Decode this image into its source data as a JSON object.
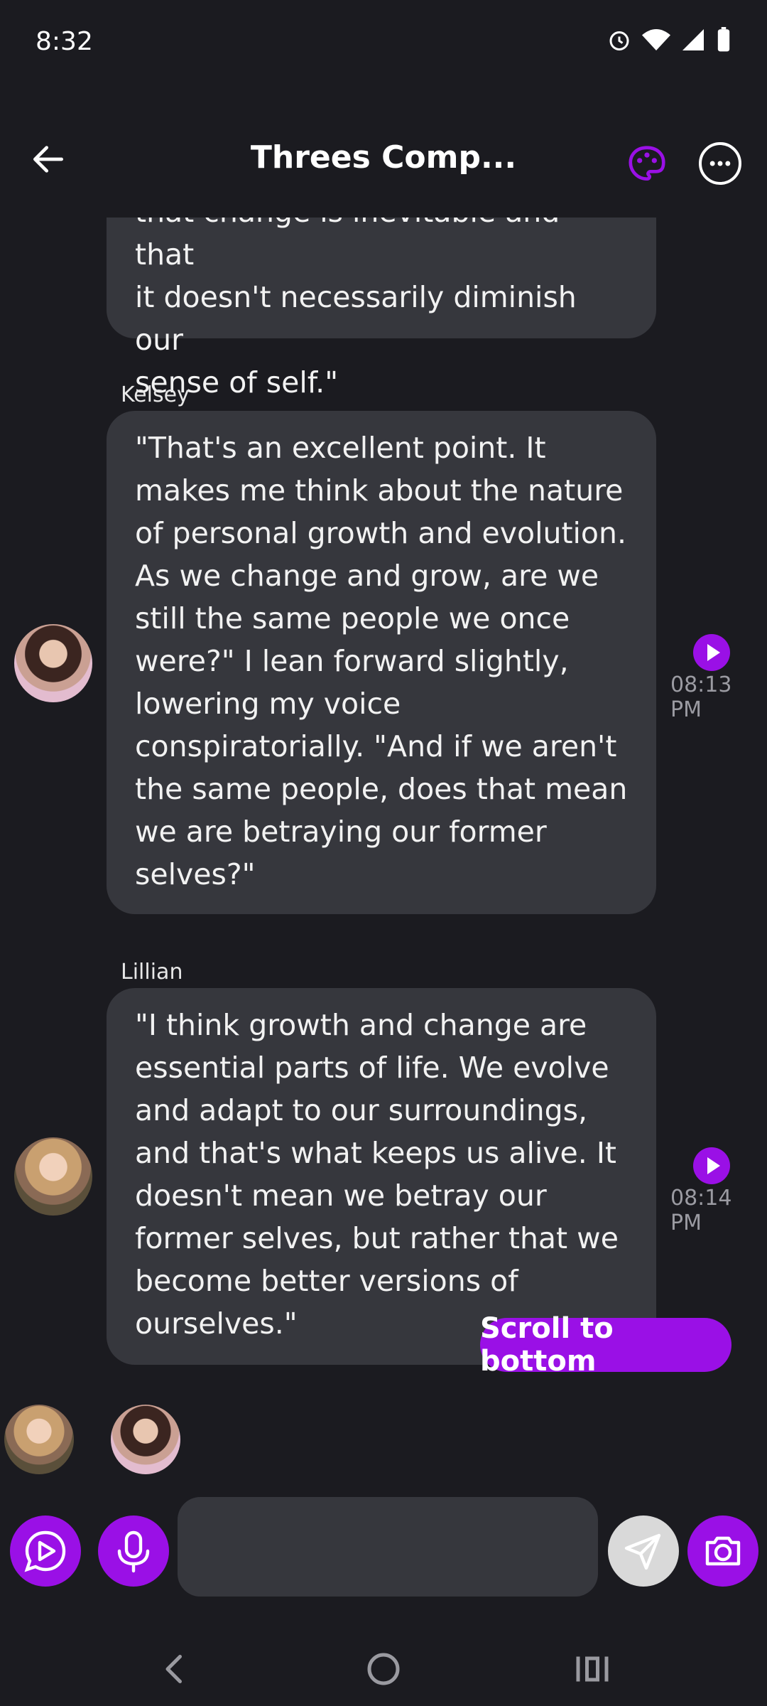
{
  "status_bar": {
    "time": "8:32"
  },
  "header": {
    "title": "Threes Comp..."
  },
  "messages": [
    {
      "sender": "",
      "text_lines": [
        "that change is inevitable and that",
        "it doesn't necessarily diminish our",
        "sense of self.\""
      ]
    },
    {
      "sender": "Kelsey",
      "time": "08:13 PM",
      "text_lines": [
        "\"That's an excellent point. It",
        "makes me think about the nature",
        "of personal growth and evolution.",
        "As we change and grow, are we",
        "still the same people we once",
        "were?\" I lean forward slightly,",
        "lowering my voice",
        "conspiratorially. \"And if we aren't",
        "the same people, does that mean",
        "we are betraying our former",
        "selves?\""
      ]
    },
    {
      "sender": "Lillian",
      "time": "08:14 PM",
      "text_lines": [
        "\"I think growth and change are",
        "essential parts of life. We evolve",
        "and adapt to our surroundings,",
        "and that's what keeps us alive. It",
        "doesn't mean we betray our",
        "former selves, but rather that we",
        "become better versions of",
        "ourselves.\""
      ]
    }
  ],
  "scroll_button": {
    "label": "Scroll to bottom"
  },
  "composer": {
    "placeholder": ""
  },
  "colors": {
    "accent": "#9a10e6",
    "bubble": "#36373d",
    "background": "#1b1b20"
  }
}
